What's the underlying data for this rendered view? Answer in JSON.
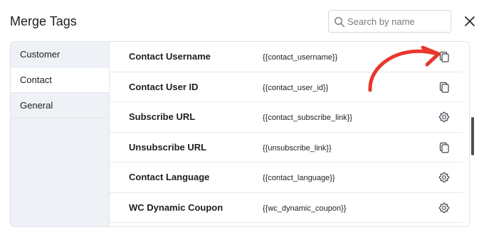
{
  "header": {
    "title": "Merge Tags",
    "search_placeholder": "Search by name"
  },
  "sidebar": {
    "items": [
      {
        "label": "Customer",
        "active": false
      },
      {
        "label": "Contact",
        "active": true
      },
      {
        "label": "General",
        "active": false
      }
    ]
  },
  "tags": [
    {
      "name": "Contact Username",
      "code": "{{contact_username}}",
      "action_icon": "copy-icon"
    },
    {
      "name": "Contact User ID",
      "code": "{{contact_user_id}}",
      "action_icon": "copy-icon"
    },
    {
      "name": "Subscribe URL",
      "code": "{{contact_subscribe_link}}",
      "action_icon": "gear-icon"
    },
    {
      "name": "Unsubscribe URL",
      "code": "{{unsubscribe_link}}",
      "action_icon": "copy-icon"
    },
    {
      "name": "Contact Language",
      "code": "{{contact_language}}",
      "action_icon": "gear-icon"
    },
    {
      "name": "WC Dynamic Coupon",
      "code": "{{wc_dynamic_coupon}}",
      "action_icon": "gear-icon"
    }
  ],
  "colors": {
    "sidebar_bg": "#eef2f6",
    "annotation_arrow": "#e8372c",
    "scrollbar_thumb": "#4b4f54"
  }
}
